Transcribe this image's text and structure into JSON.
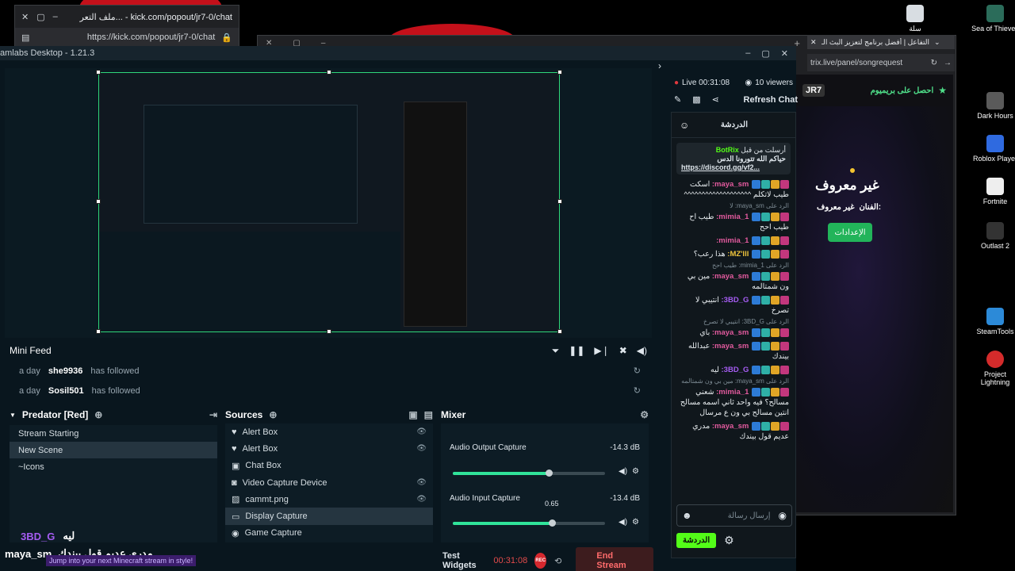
{
  "popout_window": {
    "tab_title": "ملف التعر... - kick.com/popout/jr7-0/chat",
    "url": "https://kick.com/popout/jr7-0/chat"
  },
  "browser2": {
    "tab_title": "التفاعل | أفضل برنامج لتعزيز البث الـ",
    "url": "trix.live/panel/songrequest",
    "premium_label": "احصل على بريميوم",
    "logo_text": "JR7",
    "song_title": "غير معروف",
    "artist_label": "الفنان:",
    "artist_value": "غير معروف",
    "settings_button": "الإعدادات"
  },
  "desktop_icons": [
    {
      "label": "سلة",
      "color": "#d8dde2"
    },
    {
      "label": "Sea of Thieves",
      "color": "#2b6c5a"
    },
    {
      "label": "Dark Hours",
      "color": "#5a5a5a"
    },
    {
      "label": "Roblox Player",
      "color": "#2f6ae0"
    },
    {
      "label": "Fortnite",
      "color": "#eeeeee"
    },
    {
      "label": "Outlast 2",
      "color": "#333333"
    },
    {
      "label": "SteamTools",
      "color": "#2c8ad8"
    },
    {
      "label": "Project Lightning",
      "color": "#d42b2b"
    }
  ],
  "app": {
    "title": "amlabs Desktop - 1.21.3"
  },
  "minifeed": {
    "title": "Mini Feed",
    "rows": [
      {
        "time": "a day",
        "user": "she9936",
        "action": "has followed"
      },
      {
        "time": "a day",
        "user": "Sosil501",
        "action": "has followed"
      }
    ]
  },
  "scenes": {
    "title": "Predator [Red]",
    "items": [
      "Stream Starting",
      "New Scene",
      "~Icons"
    ],
    "selected": 1
  },
  "sources": {
    "title": "Sources",
    "items": [
      {
        "label": "Alert Box",
        "icon": "alert-box-icon",
        "glyph": "♥"
      },
      {
        "label": "Alert Box",
        "icon": "alert-box-icon",
        "glyph": "♥"
      },
      {
        "label": "Chat Box",
        "icon": "chat-box-icon",
        "glyph": "▣"
      },
      {
        "label": "Video Capture Device",
        "icon": "camera-icon",
        "glyph": "◙"
      },
      {
        "label": "cammt.png",
        "icon": "image-icon",
        "glyph": "▨"
      },
      {
        "label": "Display Capture",
        "icon": "monitor-icon",
        "glyph": "▭"
      },
      {
        "label": "Game Capture",
        "icon": "gamepad-icon",
        "glyph": "◉"
      }
    ],
    "selected": 5
  },
  "mixer": {
    "title": "Mixer",
    "tracks": [
      {
        "name": "Audio Output Capture",
        "db": "-14.3 dB",
        "level": 0.63
      },
      {
        "name": "Audio Input Capture",
        "db": "-13.4 dB",
        "level": 0.65,
        "tooltip": "0.65"
      }
    ]
  },
  "footer": {
    "test_widgets": "Test Widgets",
    "timer": "00:31:08",
    "rec_label": "REC",
    "end_stream": "End Stream"
  },
  "ticker": {
    "user1": "3BD_G",
    "msg1": "ليه",
    "user2": "maya_sm",
    "msg2": "مدري عديم قول بيندك",
    "banner": "Jump into your next Minecraft stream in style!"
  },
  "chat_panel": {
    "live_label": "Live 00:31:08",
    "viewers": "10 viewers",
    "refresh": "Refresh Chat",
    "header_title": "الدردشة",
    "pinned_user": "BotRix",
    "pinned_prefix": "أرسلت من قبل",
    "pinned_text": "حياكم الله تتورونا الدس",
    "pinned_link": "https://discord.gg/vf2...",
    "input_placeholder": "إرسال رسالة",
    "send_button": "الدردشة"
  },
  "chat_messages": [
    {
      "user": "maya_sm:",
      "color": "#e25a9e",
      "text": "اسكت طيب لاتكلم ^^^^^^^^^^^^^^^^^^^"
    },
    {
      "reply": "الرد على maya_sm: لا"
    },
    {
      "user": "1_mimia:",
      "color": "#e25a9e",
      "text": "طيب اح طيب احح"
    },
    {
      "user": "1_mimia:",
      "color": "#e25a9e",
      "text": ""
    },
    {
      "user": "MZ'lll:",
      "color": "#f0c53c",
      "text": "هذا رعب؟"
    },
    {
      "reply": "الرد على 1_mimia: طيب احح"
    },
    {
      "user": "maya_sm:",
      "color": "#e25a9e",
      "text": "مين بي ون شمتالمه"
    },
    {
      "user": "3BD_G:",
      "color": "#a55cf2",
      "text": "انتيبي لا تصرخ"
    },
    {
      "reply": "الرد على 3BD_G: انتيبي لا تصرخ"
    },
    {
      "user": "maya_sm:",
      "color": "#e25a9e",
      "text": "باي"
    },
    {
      "user": "maya_sm:",
      "color": "#e25a9e",
      "text": "عبدالله بيندك"
    },
    {
      "user": "3BD_G:",
      "color": "#a55cf2",
      "text": "ليه"
    },
    {
      "reply": "الرد على maya_sm: مين بي ون شمتالمه"
    },
    {
      "user": "1_mimia:",
      "color": "#e25a9e",
      "text": "شعني مسالح؟ فيه واحد ثاني اسمه مسالح انتين مسالح بي ون ع مرسال"
    },
    {
      "user": "maya_sm:",
      "color": "#e25a9e",
      "text": "مدري عديم قول بيندك"
    }
  ]
}
